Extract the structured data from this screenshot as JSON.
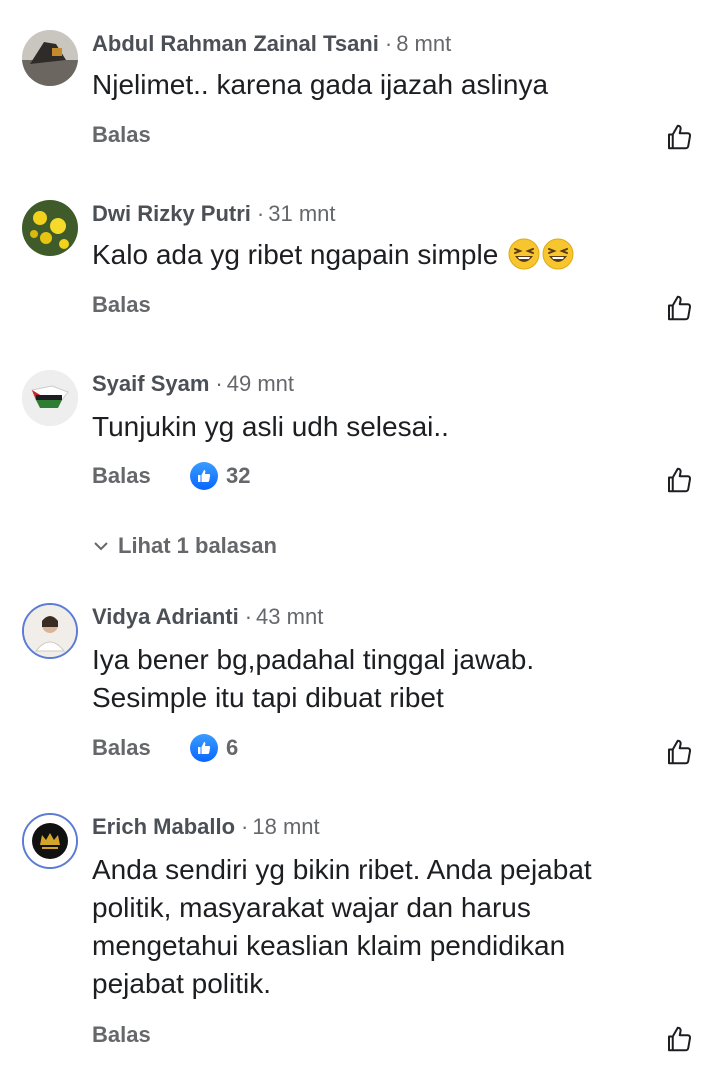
{
  "comments": [
    {
      "name": "Abdul Rahman Zainal Tsani",
      "time": "8 mnt",
      "lines": [
        "Njelimet.. karena gada ijazah aslinya"
      ],
      "reply_label": "Balas"
    },
    {
      "name": "Dwi Rizky Putri",
      "time": "31 mnt",
      "lines": [
        "Kalo ada yg ribet ngapain simple"
      ],
      "emoji": "laughing-emoji",
      "reply_label": "Balas"
    },
    {
      "name": "Syaif Syam",
      "time": "49 mnt",
      "lines": [
        "Tunjukin yg asli udh selesai.."
      ],
      "reply_label": "Balas",
      "like_count": "32",
      "view_replies_label": "Lihat 1 balasan"
    },
    {
      "name": "Vidya Adrianti",
      "time": "43 mnt",
      "lines": [
        "Iya bener bg,padahal tinggal jawab.",
        "Sesimple itu tapi dibuat ribet"
      ],
      "reply_label": "Balas",
      "like_count": "6"
    },
    {
      "name": "Erich Maballo",
      "time": "18 mnt",
      "lines": [
        "Anda sendiri yg bikin ribet. Anda pejabat",
        "politik, masyarakat wajar dan harus",
        "mengetahui keaslian klaim pendidikan",
        "pejabat politik."
      ],
      "reply_label": "Balas"
    }
  ],
  "separator": "·",
  "colors": {
    "accent": "#0866ff",
    "secondary_text": "#65676b"
  },
  "icons": {
    "like_button": "thumbs-up-outline-icon",
    "reaction": "like-reaction-icon",
    "expand": "chevron-down-icon"
  }
}
